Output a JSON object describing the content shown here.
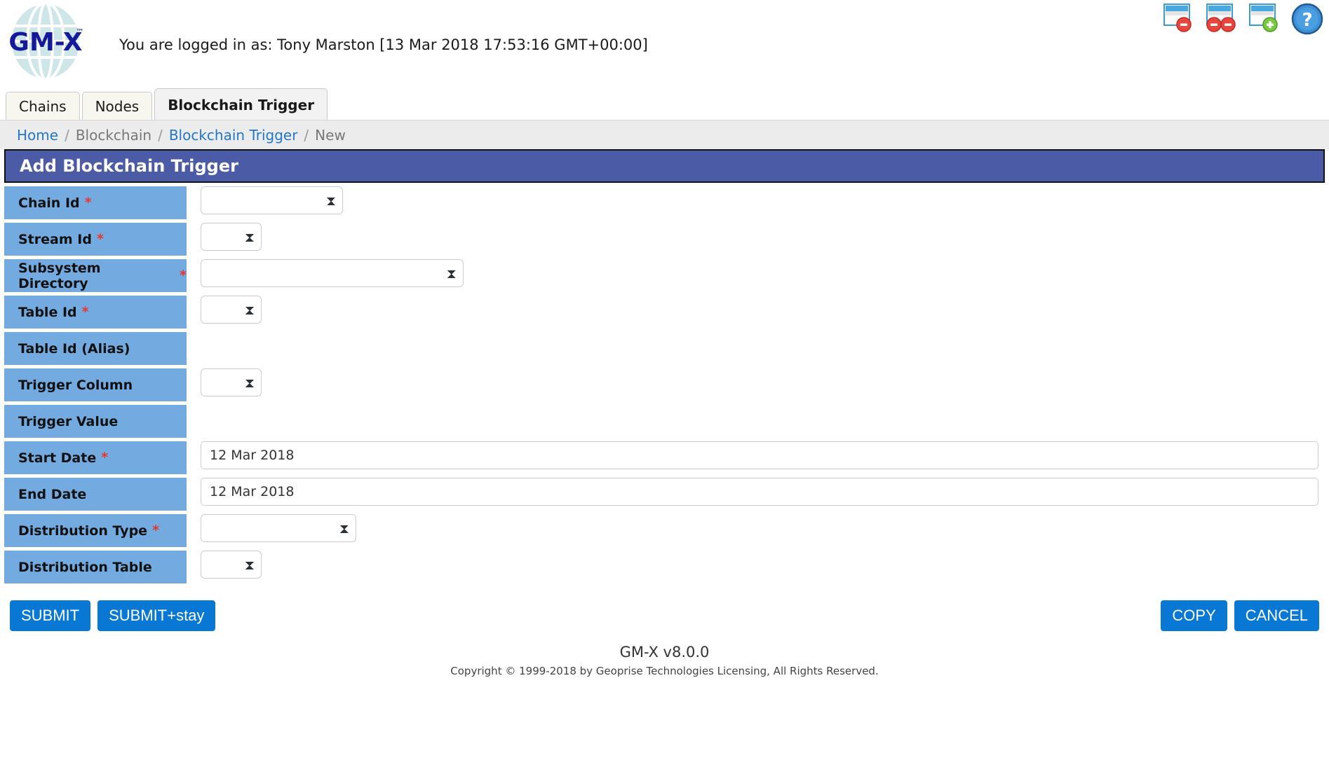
{
  "header": {
    "logo_text": "GM-X",
    "logo_tm": "™",
    "login_text": "You are logged in as: Tony Marston [13 Mar 2018 17:53:16 GMT+00:00]",
    "icons": [
      {
        "name": "close-window-icon",
        "label": "Close Window"
      },
      {
        "name": "close-all-windows-icon",
        "label": "Close All Windows"
      },
      {
        "name": "new-window-icon",
        "label": "New Window"
      },
      {
        "name": "help-icon",
        "label": "Help"
      }
    ]
  },
  "tabs": [
    {
      "label": "Chains",
      "active": false
    },
    {
      "label": "Nodes",
      "active": false
    },
    {
      "label": "Blockchain Trigger",
      "active": true
    }
  ],
  "breadcrumb": {
    "items": [
      {
        "label": "Home",
        "type": "link"
      },
      {
        "label": "Blockchain",
        "type": "static"
      },
      {
        "label": "Blockchain Trigger",
        "type": "link"
      },
      {
        "label": "New",
        "type": "static"
      }
    ],
    "separator": "/"
  },
  "page_title": "Add Blockchain Trigger",
  "form": {
    "required_marker": "*",
    "fields": [
      {
        "label": "Chain Id",
        "required": true,
        "control": "select",
        "value": ""
      },
      {
        "label": "Stream Id",
        "required": true,
        "control": "select",
        "value": ""
      },
      {
        "label": "Subsystem Directory",
        "required": true,
        "control": "select",
        "value": ""
      },
      {
        "label": "Table Id",
        "required": true,
        "control": "select",
        "value": ""
      },
      {
        "label": "Table Id (Alias)",
        "required": false,
        "control": "none",
        "value": ""
      },
      {
        "label": "Trigger Column",
        "required": false,
        "control": "select",
        "value": ""
      },
      {
        "label": "Trigger Value",
        "required": false,
        "control": "none",
        "value": ""
      },
      {
        "label": "Start Date",
        "required": true,
        "control": "text",
        "value": "12 Mar 2018"
      },
      {
        "label": "End Date",
        "required": false,
        "control": "text",
        "value": "12 Mar 2018"
      },
      {
        "label": "Distribution Type",
        "required": true,
        "control": "select",
        "value": ""
      },
      {
        "label": "Distribution Table",
        "required": false,
        "control": "select",
        "value": ""
      }
    ]
  },
  "buttons": {
    "submit": "SUBMIT",
    "submit_stay": "SUBMIT+stay",
    "copy": "COPY",
    "cancel": "CANCEL"
  },
  "footer": {
    "version": "GM-X v8.0.0",
    "copyright": "Copyright © 1999-2018 by Geoprise Technologies Licensing, All Rights Reserved."
  },
  "colors": {
    "title_bar": "#4c5ba6",
    "label_bg": "#73abe0",
    "button_blue": "#0878d4",
    "link_blue": "#2277cc",
    "required_red": "#e8352b"
  }
}
